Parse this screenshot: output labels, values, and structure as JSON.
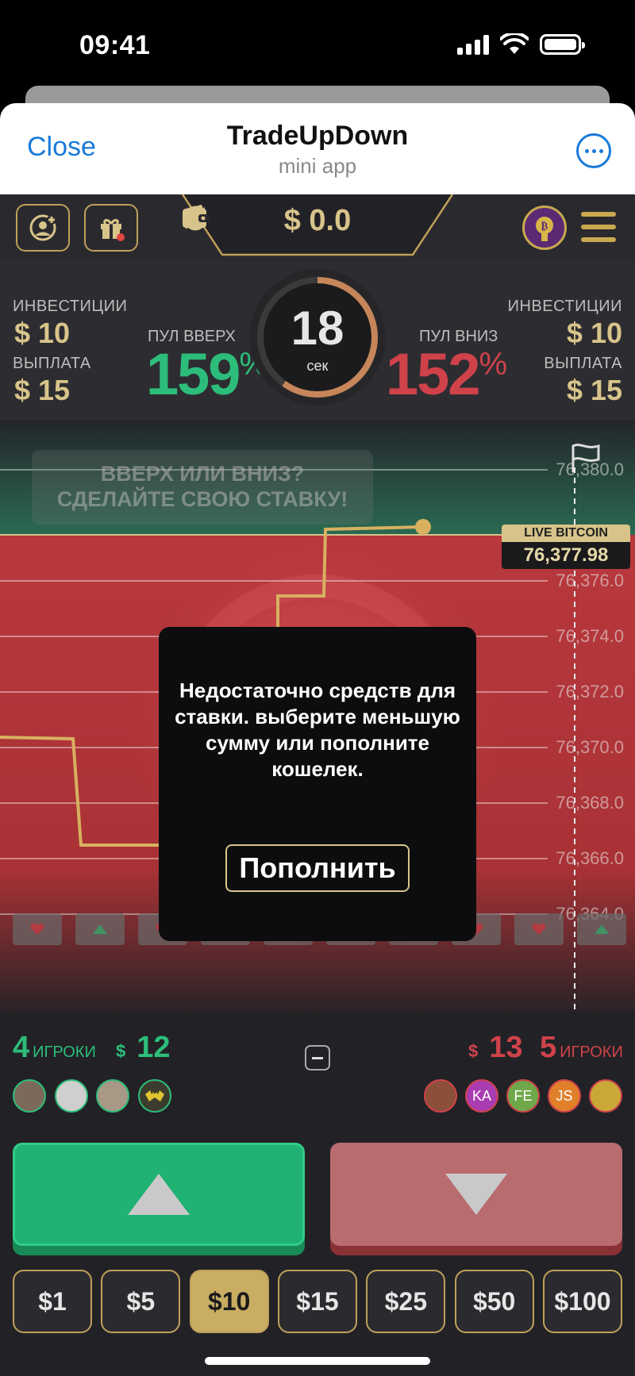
{
  "status_bar": {
    "time": "09:41"
  },
  "sheet": {
    "close_label": "Close",
    "title": "TradeUpDown",
    "subtitle": "mini app"
  },
  "topbar": {
    "balance": "$ 0.0"
  },
  "stats": {
    "left": {
      "invest_label": "ИНВЕСТИЦИИ",
      "invest_value": "$ 10",
      "payout_label": "ВЫПЛАТА",
      "payout_value": "$ 15"
    },
    "right": {
      "invest_label": "ИНВЕСТИЦИИ",
      "invest_value": "$ 10",
      "payout_label": "ВЫПЛАТА",
      "payout_value": "$ 15"
    },
    "pool_up_label": "ПУЛ ВВЕРХ",
    "pool_up_value": "159",
    "pool_down_label": "ПУЛ ВНИЗ",
    "pool_down_value": "152",
    "percent_sign": "%",
    "timer_value": "18",
    "timer_unit": "сек",
    "timer_progress": 0.6
  },
  "chart": {
    "prompt_line1": "ВВЕРХ ИЛИ ВНИЗ?",
    "prompt_line2": "СДЕЛАЙТЕ СВОЮ СТАВКУ!",
    "live_label": "LIVE BITCOIN",
    "live_price": "76,377.98",
    "ticks": [
      "76,380.0",
      "76,376.0",
      "76,374.0",
      "76,372.0",
      "76,370.0",
      "76,368.0",
      "76,366.0",
      "76,364.0"
    ],
    "history": [
      "down",
      "up",
      "down",
      "up",
      "up",
      "down",
      "down",
      "down",
      "down",
      "up"
    ]
  },
  "modal": {
    "message": "Недостаточно средств для ставки. выберите меньшую сумму или пополните кошелек.",
    "button_label": "Пополнить"
  },
  "players": {
    "up_count": "4",
    "up_word": "ИГРОКИ",
    "up_currency": "$",
    "up_sum": "12",
    "down_currency": "$",
    "down_sum": "13",
    "down_count": "5",
    "down_word": "ИГРОКИ",
    "down_avatars": [
      "KA",
      "FE",
      "JS"
    ]
  },
  "amounts": [
    "$1",
    "$5",
    "$10",
    "$15",
    "$25",
    "$50",
    "$100"
  ],
  "selected_amount": "$10",
  "colors": {
    "up": "#2dbd7a",
    "down": "#d0424a",
    "gold": "#d8c48a"
  }
}
